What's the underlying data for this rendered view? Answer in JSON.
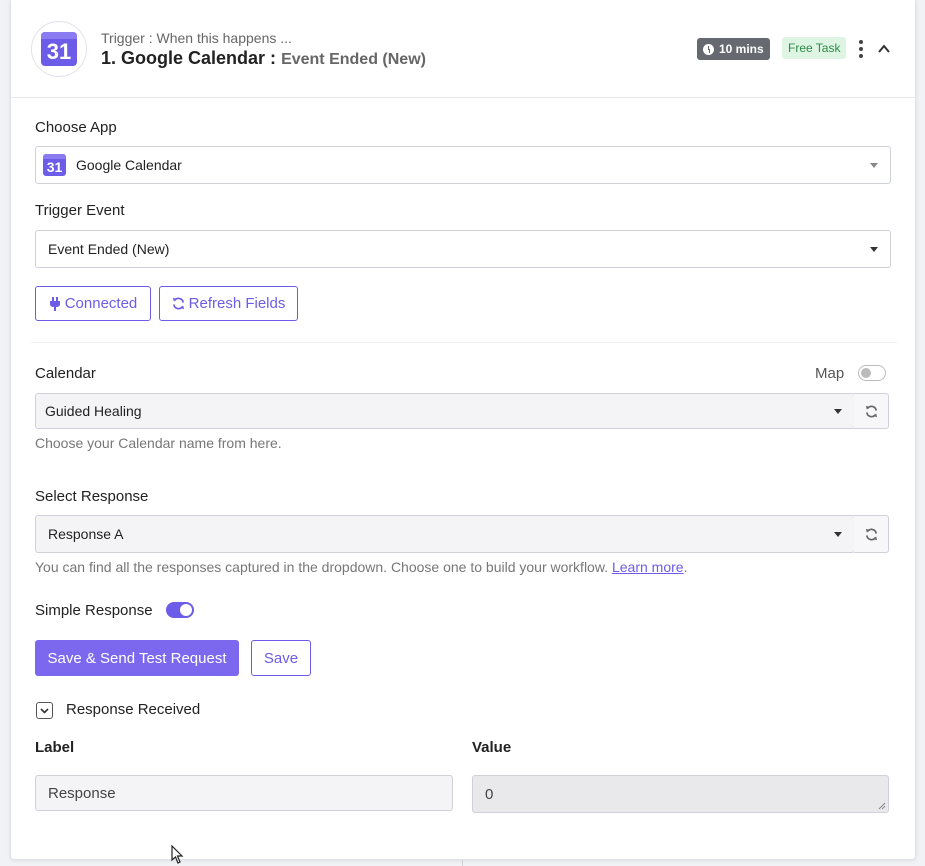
{
  "header": {
    "subtitle": "Trigger : When this happens ...",
    "title": "1. Google Calendar :",
    "event": "Event Ended (New)",
    "logo_text": "31",
    "time_badge": "10 mins",
    "plan_badge": "Free Task",
    "icons": [
      "clock-icon",
      "kebab-menu-icon",
      "chevron-up-icon"
    ]
  },
  "choose_app": {
    "label": "Choose App",
    "value": "Google Calendar",
    "icon_text": "31"
  },
  "trigger_event": {
    "label": "Trigger Event",
    "value": "Event Ended (New)"
  },
  "buttons": {
    "connected": "Connected",
    "refresh_fields": "Refresh Fields",
    "save_send": "Save & Send Test Request",
    "save": "Save"
  },
  "calendar": {
    "label": "Calendar",
    "map_label": "Map",
    "map_enabled": false,
    "value": "Guided Healing",
    "help": "Choose your Calendar name from here."
  },
  "select_response": {
    "label": "Select Response",
    "value": "Response A",
    "help": "You can find all the responses captured in the dropdown. Choose one to build your workflow.",
    "learn_more": "Learn more",
    "period": "."
  },
  "simple_response": {
    "label": "Simple Response",
    "enabled": true
  },
  "response_received": {
    "label": "Response Received",
    "expanded": true,
    "label_header": "Label",
    "value_header": "Value",
    "row_label": "Response",
    "row_value": "0"
  },
  "colors": {
    "accent": "#6c5ce7",
    "primary_button": "#7b68ee",
    "free_badge_bg": "#dff5e4",
    "free_badge_text": "#2e8a48",
    "time_badge_bg": "#666a70"
  }
}
